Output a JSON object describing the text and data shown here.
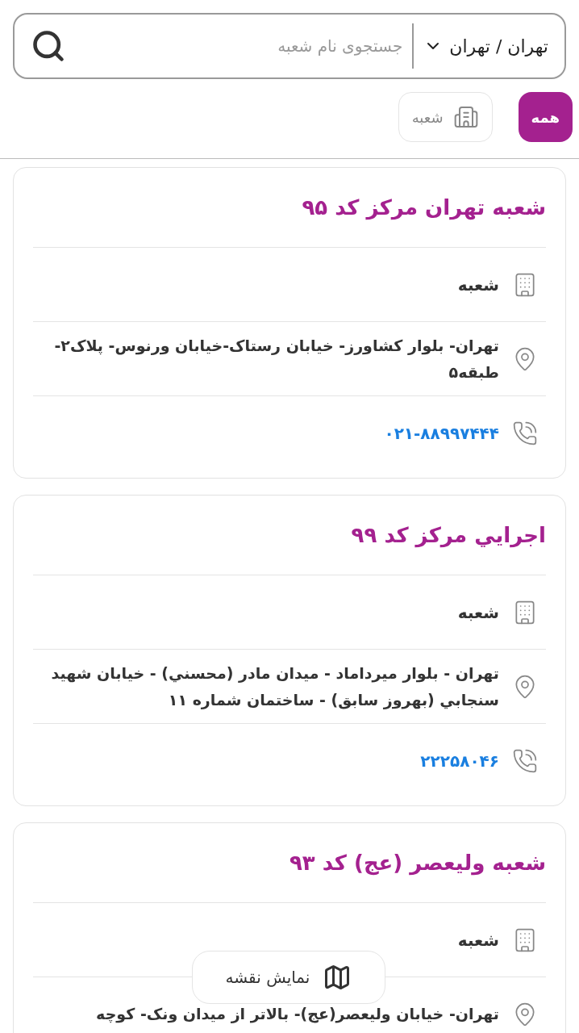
{
  "search": {
    "city": "تهران / تهران",
    "placeholder": "جستجوی نام شعبه"
  },
  "filters": [
    {
      "label": "همه",
      "selected": true,
      "kind": "plain"
    },
    {
      "label": "شعبه",
      "selected": false,
      "kind": "building"
    }
  ],
  "branches": [
    {
      "title": "شعبه تهران مرکز کد ۹۵",
      "type": "شعبه",
      "address": "تهران- بلوار کشاورز- خیابان رستاک-خیابان ورنوس- پلاک۲-طبقه۵",
      "phone": "۰۲۱-۸۸۹۹۷۴۴۴"
    },
    {
      "title": "اجرايي مرکز کد ۹۹",
      "type": "شعبه",
      "address": "تهران - بلوار ميرداماد - ميدان مادر (محسني) - خيابان شهيد سنجابي (بهروز سابق) - ساختمان شماره ۱۱",
      "phone": "۲۲۲۵۸۰۴۶"
    },
    {
      "title": "شعبه ولیعصر (عج) کد ۹۳",
      "type": "شعبه",
      "address": "تهران- خیابان ولیعصر(عج)- بالاتر از میدان ونک- کوچه"
    }
  ],
  "map_button": {
    "label": "نمایش نقشه"
  }
}
